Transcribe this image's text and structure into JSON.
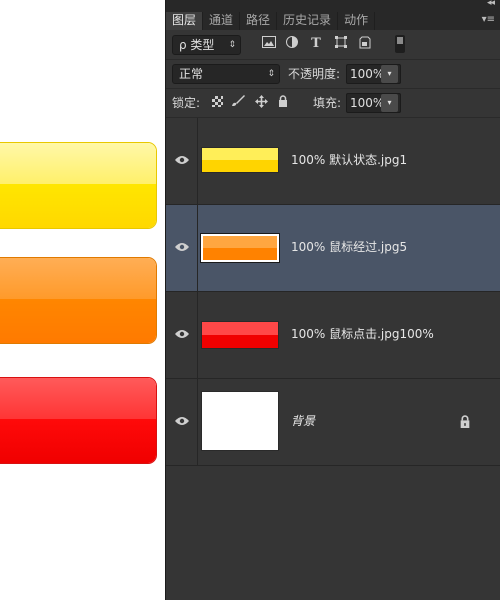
{
  "canvas": {
    "buttons": [
      {
        "id": "yellow",
        "color_top": "#fff06a",
        "color_bottom": "#ffe600"
      },
      {
        "id": "orange",
        "color_top": "#ff9a2a",
        "color_bottom": "#ff7a00"
      },
      {
        "id": "red",
        "color_top": "#ff3535",
        "color_bottom": "#f00000"
      }
    ]
  },
  "panel": {
    "collapse_glyph": "◂◂",
    "tabs": [
      {
        "label": "图层",
        "active": true
      },
      {
        "label": "通道",
        "active": false
      },
      {
        "label": "路径",
        "active": false
      },
      {
        "label": "历史记录",
        "active": false
      },
      {
        "label": "动作",
        "active": false
      }
    ],
    "menu_glyph": "▾≡",
    "filter": {
      "label": "ρ 类型",
      "arrow": "⇕"
    },
    "filter_icons": [
      "image-filter-icon",
      "adjustment-filter-icon",
      "type-filter-icon",
      "shape-filter-icon",
      "smart-object-filter-icon",
      "filter-toggle-icon"
    ],
    "blend": {
      "value": "正常",
      "arrow": "⇕"
    },
    "opacity": {
      "label": "不透明度:",
      "value": "100%",
      "arrow": "▾"
    },
    "lock": {
      "label": "锁定:",
      "icons": [
        "lock-transparent-icon",
        "lock-image-icon",
        "lock-position-icon",
        "lock-all-icon"
      ]
    },
    "fill": {
      "label": "填充:",
      "value": "100%",
      "arrow": "▾"
    },
    "layers": [
      {
        "name": "100%  默认状态.jpg1",
        "selected": false,
        "thumb_top": "#ffee58",
        "thumb_bottom": "#ffd400",
        "locked": false
      },
      {
        "name": "100%  鼠标经过.jpg5",
        "selected": true,
        "thumb_top": "#ffa640",
        "thumb_bottom": "#ff8200",
        "locked": false
      },
      {
        "name": "100% 鼠标点击.jpg100%",
        "selected": false,
        "thumb_top": "#ff4848",
        "thumb_bottom": "#f00000",
        "locked": false
      },
      {
        "name": "背景",
        "selected": false,
        "thumb_top": "#ffffff",
        "thumb_bottom": "#ffffff",
        "locked": true
      }
    ]
  }
}
